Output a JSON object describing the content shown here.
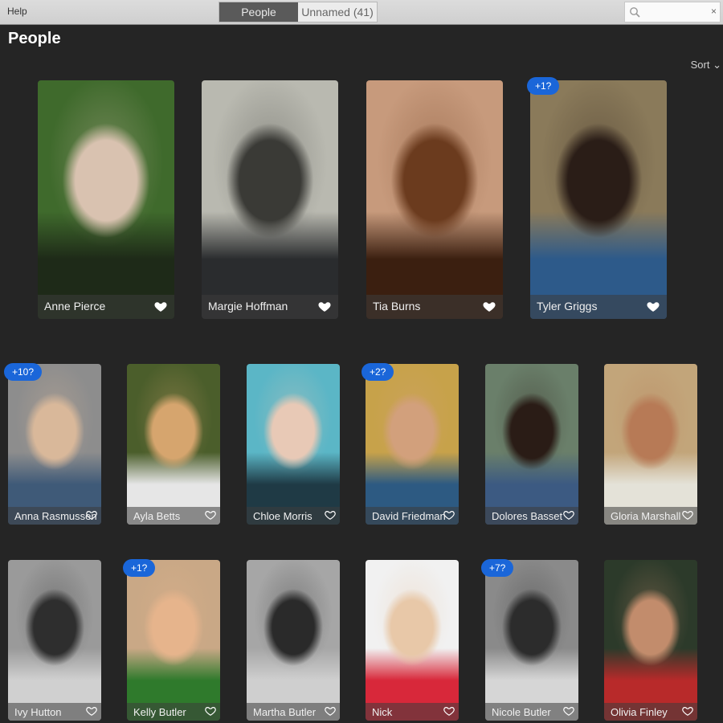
{
  "menu": {
    "help": "Help"
  },
  "tabs": [
    {
      "label": "People",
      "active": true
    },
    {
      "label": "Unnamed (41)",
      "active": false
    }
  ],
  "search": {
    "value": "",
    "placeholder": "",
    "clear_icon": "×"
  },
  "page_title": "People",
  "sort_label": "Sort ⌄",
  "people": [
    {
      "name": "Anne Pierce",
      "favorite": true,
      "badge": null,
      "colors": [
        "#3f6a2c",
        "#d9c2b0",
        "#1e2a18"
      ]
    },
    {
      "name": "Margie Hoffman",
      "favorite": true,
      "badge": null,
      "colors": [
        "#b9b9b0",
        "#3a3a36",
        "#2a2c2e"
      ]
    },
    {
      "name": "Tia Burns",
      "favorite": true,
      "badge": null,
      "colors": [
        "#c79a7c",
        "#6b3b1e",
        "#3b1f10"
      ]
    },
    {
      "name": "Tyler Griggs",
      "favorite": true,
      "badge": "+1?",
      "colors": [
        "#8a7a5a",
        "#2a1d17",
        "#2d5a8a"
      ]
    },
    {
      "name": "Anna Rasmussen",
      "favorite": false,
      "badge": "+10?",
      "colors": [
        "#8d8d8d",
        "#d9b89a",
        "#3f5a78"
      ]
    },
    {
      "name": "Ayla Betts",
      "favorite": false,
      "badge": null,
      "colors": [
        "#4b5e2b",
        "#d6a56e",
        "#e6e6e6"
      ]
    },
    {
      "name": "Chloe Morris",
      "favorite": false,
      "badge": null,
      "colors": [
        "#5bb6c6",
        "#e8c9b6",
        "#1f3a45"
      ]
    },
    {
      "name": "David Friedman",
      "favorite": false,
      "badge": "+2?",
      "colors": [
        "#c7a24a",
        "#d2a07c",
        "#2d5a82"
      ]
    },
    {
      "name": "Dolores Basset",
      "favorite": false,
      "badge": null,
      "colors": [
        "#6a7f6a",
        "#2a1c16",
        "#3c5a82"
      ]
    },
    {
      "name": "Gloria Marshall",
      "favorite": false,
      "badge": null,
      "colors": [
        "#c2a57a",
        "#b77a56",
        "#e4e2d8"
      ]
    },
    {
      "name": "Ivy Hutton",
      "favorite": false,
      "badge": null,
      "colors": [
        "#9a9a9a",
        "#2e2e2e",
        "#d0d0d0"
      ]
    },
    {
      "name": "Kelly Butler",
      "favorite": false,
      "badge": "+1?",
      "colors": [
        "#c9a886",
        "#e6b48c",
        "#2f7a2c"
      ]
    },
    {
      "name": "Martha Butler",
      "favorite": false,
      "badge": null,
      "colors": [
        "#a6a6a6",
        "#2a2a2a",
        "#cfcfcf"
      ]
    },
    {
      "name": "Nick",
      "favorite": false,
      "badge": null,
      "colors": [
        "#f1f1f1",
        "#e8c8a8",
        "#d8283a"
      ]
    },
    {
      "name": "Nicole Butler",
      "favorite": false,
      "badge": "+7?",
      "colors": [
        "#8a8a8a",
        "#2c2c2c",
        "#d6d6d6"
      ]
    },
    {
      "name": "Olivia Finley",
      "favorite": false,
      "badge": null,
      "colors": [
        "#2c3a2a",
        "#c28c6c",
        "#b82a2a"
      ]
    }
  ]
}
